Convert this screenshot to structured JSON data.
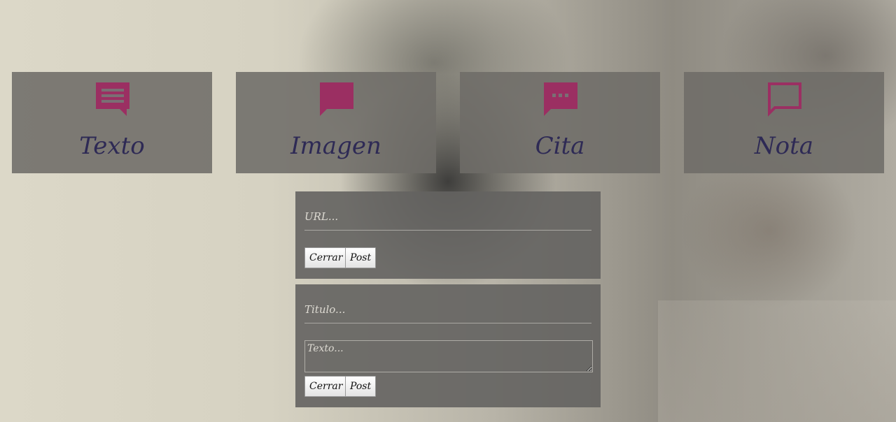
{
  "colors": {
    "accent": "#9b2f62",
    "label_text": "#2e2a55",
    "tile_bg": "#6e6c68",
    "panel_bg": "#64635f"
  },
  "tiles": [
    {
      "label": "Texto",
      "icon": "text-message-icon"
    },
    {
      "label": "Imagen",
      "icon": "chat-bubble-icon"
    },
    {
      "label": "Cita",
      "icon": "quote-bubble-icon"
    },
    {
      "label": "Nota",
      "icon": "note-bubble-outline-icon"
    }
  ],
  "url_form": {
    "url_placeholder": "URL...",
    "close_label": "Cerrar",
    "post_label": "Post"
  },
  "text_form": {
    "title_placeholder": "Titulo...",
    "body_placeholder": "Texto...",
    "close_label": "Cerrar",
    "post_label": "Post"
  }
}
